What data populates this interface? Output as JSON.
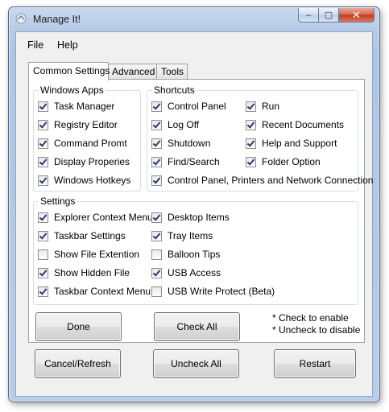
{
  "window": {
    "title": "Manage It!",
    "minimize_label": "–",
    "maximize_label": "▢",
    "close_label": "✕"
  },
  "menu": {
    "file": "File",
    "help": "Help"
  },
  "tabs": [
    {
      "label": "Common Settings",
      "active": true
    },
    {
      "label": "Advanced",
      "active": false
    },
    {
      "label": "Tools",
      "active": false
    }
  ],
  "windows_apps": {
    "title": "Windows Apps",
    "items": [
      {
        "label": "Task Manager",
        "checked": true
      },
      {
        "label": "Registry Editor",
        "checked": true
      },
      {
        "label": "Command Promt",
        "checked": true
      },
      {
        "label": "Display Properies",
        "checked": true
      },
      {
        "label": "Windows Hotkeys",
        "checked": true
      }
    ]
  },
  "shortcuts": {
    "title": "Shortcuts",
    "col1": [
      {
        "label": "Control Panel",
        "checked": true
      },
      {
        "label": "Log Off",
        "checked": true
      },
      {
        "label": "Shutdown",
        "checked": true
      },
      {
        "label": "Find/Search",
        "checked": true
      }
    ],
    "col2": [
      {
        "label": "Run",
        "checked": true
      },
      {
        "label": "Recent Documents",
        "checked": true
      },
      {
        "label": "Help and Support",
        "checked": true
      },
      {
        "label": "Folder Option",
        "checked": true
      }
    ],
    "wide": {
      "label": "Control Panel, Printers and Network Connection",
      "checked": true
    }
  },
  "settings": {
    "title": "Settings",
    "col1": [
      {
        "label": "Explorer Context Menu",
        "checked": true
      },
      {
        "label": "Taskbar Settings",
        "checked": true
      },
      {
        "label": "Show File Extention",
        "checked": false
      },
      {
        "label": "Show Hidden File",
        "checked": true
      },
      {
        "label": "Taskbar Context Menu",
        "checked": true
      }
    ],
    "col2": [
      {
        "label": "Desktop Items",
        "checked": true
      },
      {
        "label": "Tray Items",
        "checked": true
      },
      {
        "label": "Balloon Tips",
        "checked": false
      },
      {
        "label": "USB Access",
        "checked": true
      },
      {
        "label": "USB Write Protect (Beta)",
        "checked": false
      }
    ]
  },
  "buttons": {
    "done": "Done",
    "check_all": "Check All",
    "cancel_refresh": "Cancel/Refresh",
    "uncheck_all": "Uncheck All",
    "restart": "Restart"
  },
  "notes": {
    "line1": "* Check to enable",
    "line2": "* Uncheck to disable"
  }
}
